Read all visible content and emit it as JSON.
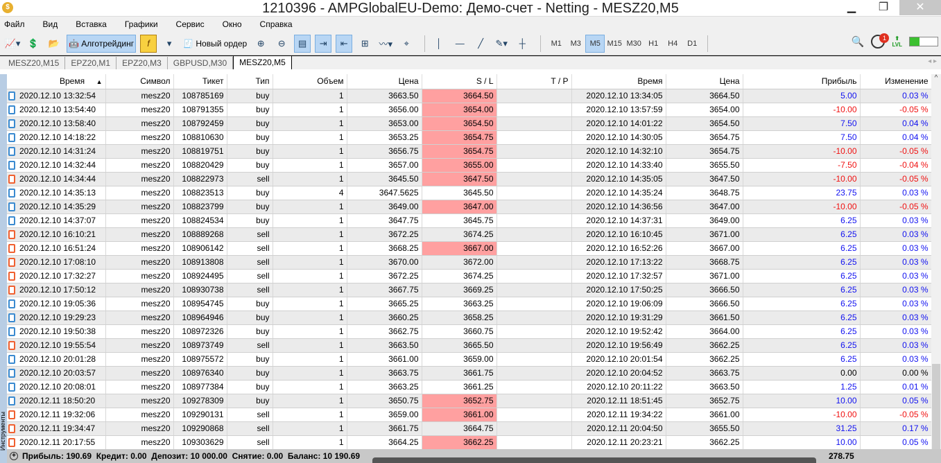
{
  "window": {
    "title": "1210396 - AMPGlobalEU-Demo: Демо-счет - Netting - MESZ20,M5"
  },
  "menu": [
    "Файл",
    "Вид",
    "Вставка",
    "Графики",
    "Сервис",
    "Окно",
    "Справка"
  ],
  "toolbar": {
    "algo_label": "Алготрейдинг",
    "new_order_label": "Новый ордер",
    "timeframes": [
      "M1",
      "M3",
      "M5",
      "M15",
      "M30",
      "H1",
      "H4",
      "D1"
    ],
    "active_timeframe": "M5",
    "notifications": "1",
    "lvl_label": "LVL",
    "signal_level_percent": 35
  },
  "tabs": [
    "MESZ20,M15",
    "EPZ20,M1",
    "EPZ20,M3",
    "GBPUSD,M30",
    "MESZ20,M5"
  ],
  "active_tab": "MESZ20,M5",
  "sidebar_label": "Инструменты",
  "colors": {
    "positive": "#1010f0",
    "negative": "#f01010",
    "sl_hit": "#ffa0a0",
    "buy_icon": "#3a8ad0",
    "sell_icon": "#f06030"
  },
  "table": {
    "columns": [
      "Время",
      "Символ",
      "Тикет",
      "Тип",
      "Объем",
      "Цена",
      "S / L",
      "T / P",
      "Время",
      "Цена",
      "Прибыль",
      "Изменение"
    ],
    "sort_column": "Время",
    "sort_dir": "asc",
    "rows": [
      [
        "2020.12.10 13:32:54",
        "mesz20",
        "108785169",
        "buy",
        "1",
        "3663.50",
        "3664.50",
        "",
        "2020.12.10 13:34:05",
        "3664.50",
        "5.00",
        "0.03 %",
        true
      ],
      [
        "2020.12.10 13:54:40",
        "mesz20",
        "108791355",
        "buy",
        "1",
        "3656.00",
        "3654.00",
        "",
        "2020.12.10 13:57:59",
        "3654.00",
        "-10.00",
        "-0.05 %",
        true
      ],
      [
        "2020.12.10 13:58:40",
        "mesz20",
        "108792459",
        "buy",
        "1",
        "3653.00",
        "3654.50",
        "",
        "2020.12.10 14:01:22",
        "3654.50",
        "7.50",
        "0.04 %",
        true
      ],
      [
        "2020.12.10 14:18:22",
        "mesz20",
        "108810630",
        "buy",
        "1",
        "3653.25",
        "3654.75",
        "",
        "2020.12.10 14:30:05",
        "3654.75",
        "7.50",
        "0.04 %",
        true
      ],
      [
        "2020.12.10 14:31:24",
        "mesz20",
        "108819751",
        "buy",
        "1",
        "3656.75",
        "3654.75",
        "",
        "2020.12.10 14:32:10",
        "3654.75",
        "-10.00",
        "-0.05 %",
        true
      ],
      [
        "2020.12.10 14:32:44",
        "mesz20",
        "108820429",
        "buy",
        "1",
        "3657.00",
        "3655.00",
        "",
        "2020.12.10 14:33:40",
        "3655.50",
        "-7.50",
        "-0.04 %",
        true
      ],
      [
        "2020.12.10 14:34:44",
        "mesz20",
        "108822973",
        "sell",
        "1",
        "3645.50",
        "3647.50",
        "",
        "2020.12.10 14:35:05",
        "3647.50",
        "-10.00",
        "-0.05 %",
        true
      ],
      [
        "2020.12.10 14:35:13",
        "mesz20",
        "108823513",
        "buy",
        "4",
        "3647.5625",
        "3645.50",
        "",
        "2020.12.10 14:35:24",
        "3648.75",
        "23.75",
        "0.03 %",
        false
      ],
      [
        "2020.12.10 14:35:29",
        "mesz20",
        "108823799",
        "buy",
        "1",
        "3649.00",
        "3647.00",
        "",
        "2020.12.10 14:36:56",
        "3647.00",
        "-10.00",
        "-0.05 %",
        true
      ],
      [
        "2020.12.10 14:37:07",
        "mesz20",
        "108824534",
        "buy",
        "1",
        "3647.75",
        "3645.75",
        "",
        "2020.12.10 14:37:31",
        "3649.00",
        "6.25",
        "0.03 %",
        false
      ],
      [
        "2020.12.10 16:10:21",
        "mesz20",
        "108889268",
        "sell",
        "1",
        "3672.25",
        "3674.25",
        "",
        "2020.12.10 16:10:45",
        "3671.00",
        "6.25",
        "0.03 %",
        false
      ],
      [
        "2020.12.10 16:51:24",
        "mesz20",
        "108906142",
        "sell",
        "1",
        "3668.25",
        "3667.00",
        "",
        "2020.12.10 16:52:26",
        "3667.00",
        "6.25",
        "0.03 %",
        true
      ],
      [
        "2020.12.10 17:08:10",
        "mesz20",
        "108913808",
        "sell",
        "1",
        "3670.00",
        "3672.00",
        "",
        "2020.12.10 17:13:22",
        "3668.75",
        "6.25",
        "0.03 %",
        false
      ],
      [
        "2020.12.10 17:32:27",
        "mesz20",
        "108924495",
        "sell",
        "1",
        "3672.25",
        "3674.25",
        "",
        "2020.12.10 17:32:57",
        "3671.00",
        "6.25",
        "0.03 %",
        false
      ],
      [
        "2020.12.10 17:50:12",
        "mesz20",
        "108930738",
        "sell",
        "1",
        "3667.75",
        "3669.25",
        "",
        "2020.12.10 17:50:25",
        "3666.50",
        "6.25",
        "0.03 %",
        false
      ],
      [
        "2020.12.10 19:05:36",
        "mesz20",
        "108954745",
        "buy",
        "1",
        "3665.25",
        "3663.25",
        "",
        "2020.12.10 19:06:09",
        "3666.50",
        "6.25",
        "0.03 %",
        false
      ],
      [
        "2020.12.10 19:29:23",
        "mesz20",
        "108964946",
        "buy",
        "1",
        "3660.25",
        "3658.25",
        "",
        "2020.12.10 19:31:29",
        "3661.50",
        "6.25",
        "0.03 %",
        false
      ],
      [
        "2020.12.10 19:50:38",
        "mesz20",
        "108972326",
        "buy",
        "1",
        "3662.75",
        "3660.75",
        "",
        "2020.12.10 19:52:42",
        "3664.00",
        "6.25",
        "0.03 %",
        false
      ],
      [
        "2020.12.10 19:55:54",
        "mesz20",
        "108973749",
        "sell",
        "1",
        "3663.50",
        "3665.50",
        "",
        "2020.12.10 19:56:49",
        "3662.25",
        "6.25",
        "0.03 %",
        false
      ],
      [
        "2020.12.10 20:01:28",
        "mesz20",
        "108975572",
        "buy",
        "1",
        "3661.00",
        "3659.00",
        "",
        "2020.12.10 20:01:54",
        "3662.25",
        "6.25",
        "0.03 %",
        false
      ],
      [
        "2020.12.10 20:03:57",
        "mesz20",
        "108976340",
        "buy",
        "1",
        "3663.75",
        "3661.75",
        "",
        "2020.12.10 20:04:52",
        "3663.75",
        "0.00",
        "0.00 %",
        false
      ],
      [
        "2020.12.10 20:08:01",
        "mesz20",
        "108977384",
        "buy",
        "1",
        "3663.25",
        "3661.25",
        "",
        "2020.12.10 20:11:22",
        "3663.50",
        "1.25",
        "0.01 %",
        false
      ],
      [
        "2020.12.11 18:50:20",
        "mesz20",
        "109278309",
        "buy",
        "1",
        "3650.75",
        "3652.75",
        "",
        "2020.12.11 18:51:45",
        "3652.75",
        "10.00",
        "0.05 %",
        true
      ],
      [
        "2020.12.11 19:32:06",
        "mesz20",
        "109290131",
        "sell",
        "1",
        "3659.00",
        "3661.00",
        "",
        "2020.12.11 19:34:22",
        "3661.00",
        "-10.00",
        "-0.05 %",
        true
      ],
      [
        "2020.12.11 19:34:47",
        "mesz20",
        "109290868",
        "sell",
        "1",
        "3661.75",
        "3664.75",
        "",
        "2020.12.11 20:04:50",
        "3655.50",
        "31.25",
        "0.17 %",
        false
      ],
      [
        "2020.12.11 20:17:55",
        "mesz20",
        "109303629",
        "sell",
        "1",
        "3664.25",
        "3662.25",
        "",
        "2020.12.11 20:23:21",
        "3662.25",
        "10.00",
        "0.05 %",
        true
      ]
    ]
  },
  "footer": {
    "summary": "Прибыль: 190.69  Кредит: 0.00  Депозит: 10 000.00  Снятие: 0.00  Баланс: 10 190.69",
    "total": "278.75"
  }
}
